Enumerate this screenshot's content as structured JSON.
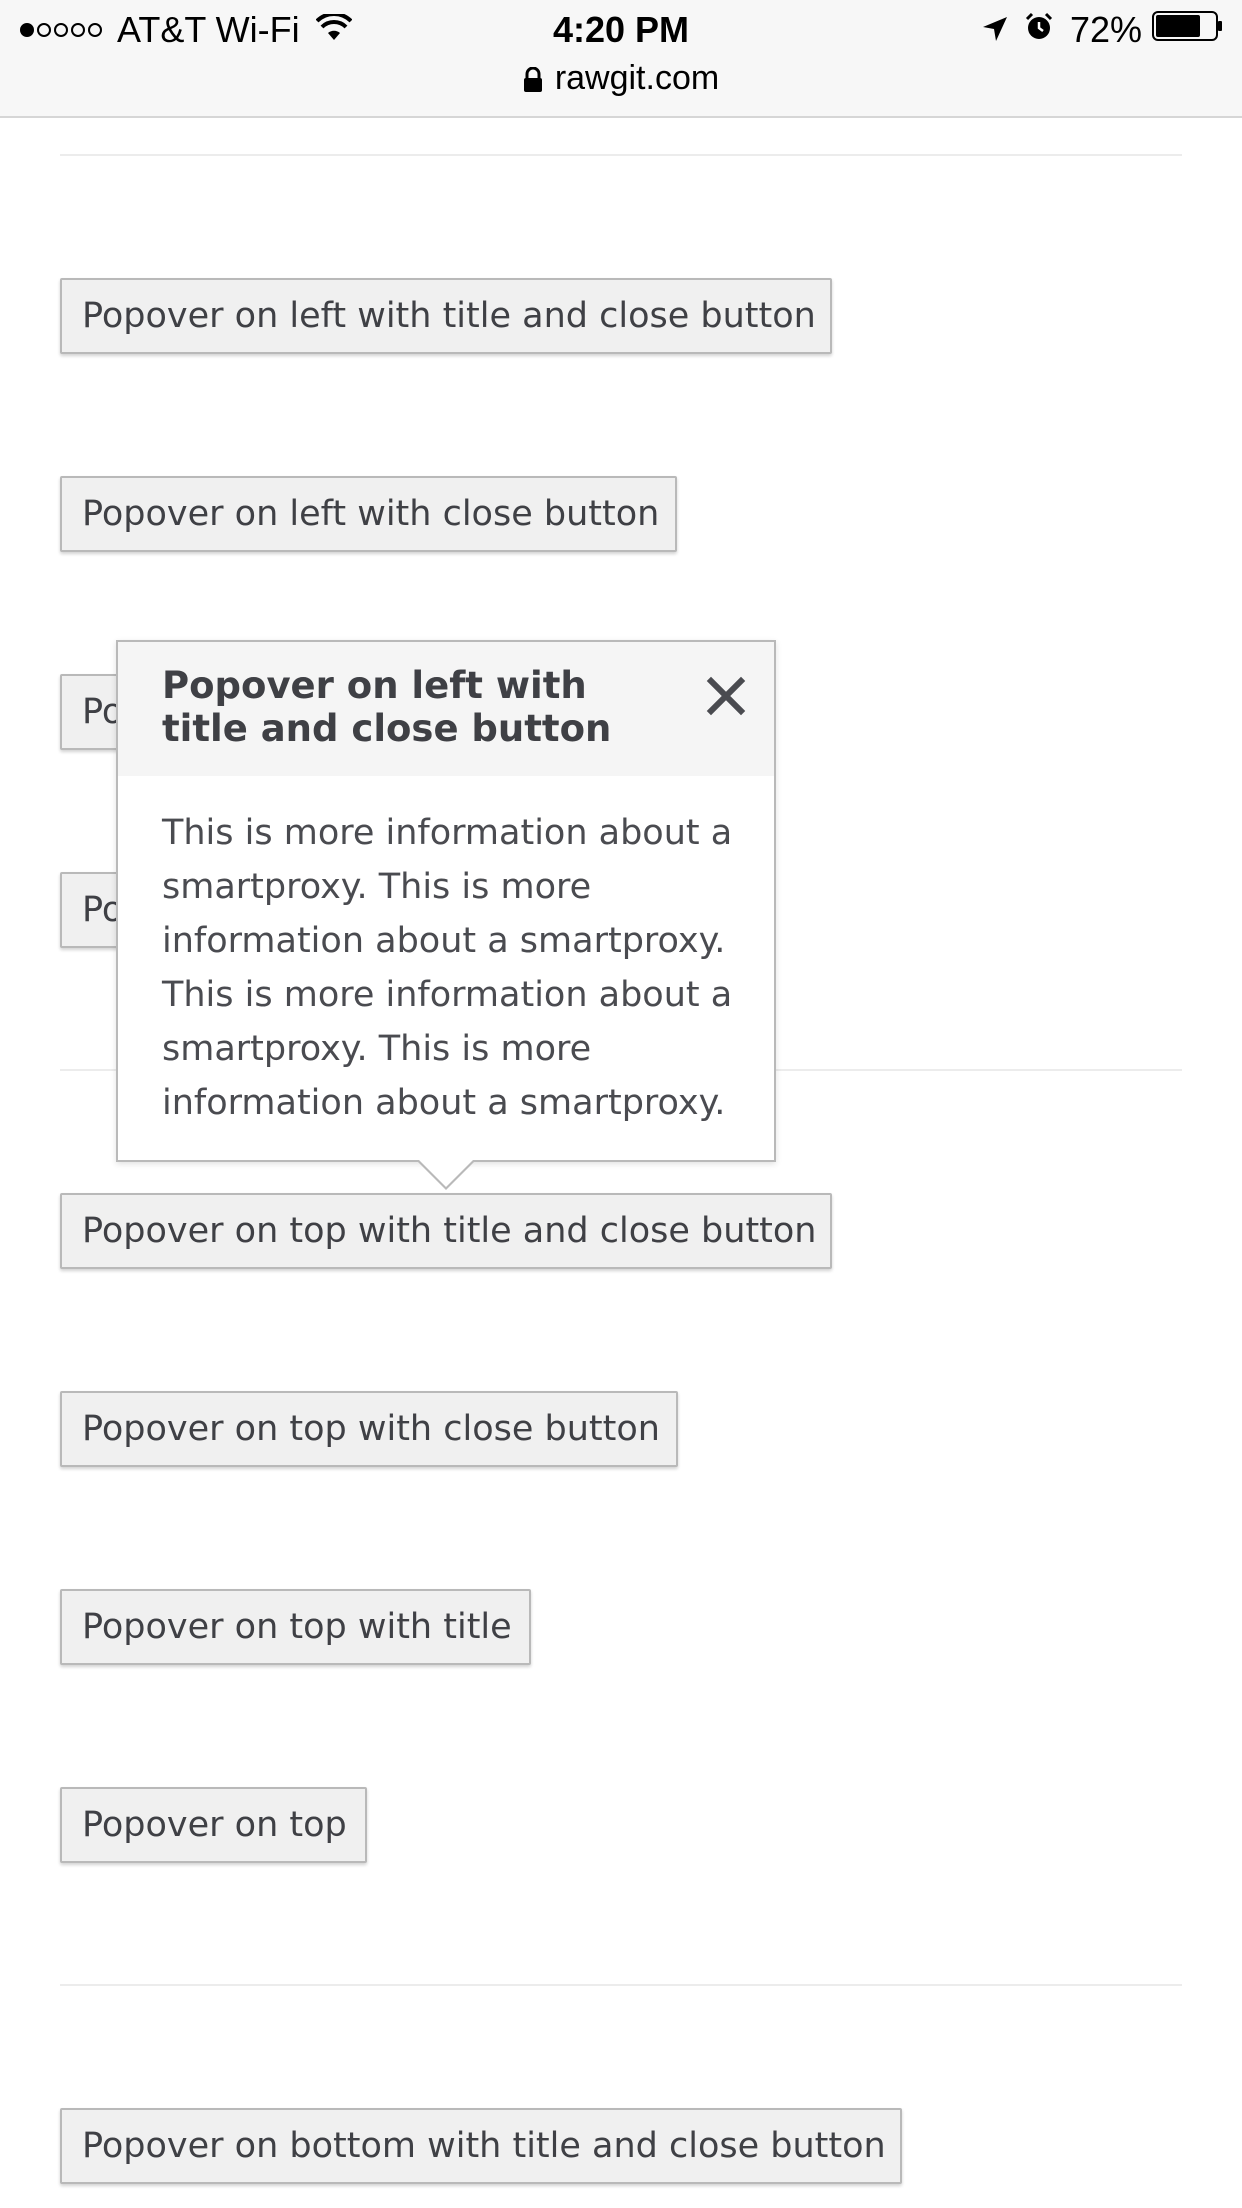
{
  "status_bar": {
    "carrier": "AT&T Wi-Fi",
    "time": "4:20 PM",
    "url": "rawgit.com",
    "battery": "72%",
    "signal_dots_filled": 1,
    "signal_dots_total": 5,
    "icons": [
      "wifi-icon",
      "lock-icon",
      "location-arrow-icon",
      "alarm-icon",
      "battery-icon"
    ]
  },
  "buttons": {
    "left_title_close": "Popover on left with title and close button",
    "left_close": "Popover on left with close button",
    "left_title_partial": "Po",
    "left_plain_partial": "Po",
    "top_title_close": "Popover on top with title and close button",
    "top_close": "Popover on top with close button",
    "top_title": "Popover on top with title",
    "top": "Popover on top",
    "bottom_title_close": "Popover on bottom with title and close button"
  },
  "popover": {
    "title": "Popover on left with title and close button",
    "body": "This is more information about a smartproxy. This is more information about a smartproxy. This is more information about a smartproxy. This is more information about a smartproxy.",
    "close_icon": "close-icon"
  },
  "colors": {
    "button_bg": "#f0f0f0",
    "button_border": "#b9b9b9",
    "text": "#3f4045",
    "popover_header_bg": "#f5f5f5"
  }
}
